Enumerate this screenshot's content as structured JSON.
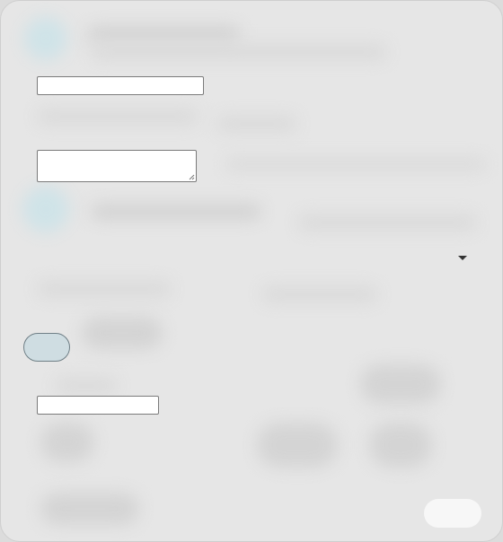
{
  "form": {
    "name_input": {
      "value": "",
      "placeholder": ""
    },
    "notes_textarea": {
      "value": "",
      "placeholder": ""
    },
    "select": {
      "selected": ""
    },
    "toggle_button_label": "",
    "short_input": {
      "value": "",
      "placeholder": ""
    },
    "submit_button_label": ""
  },
  "colors": {
    "dialog_background": "#e6e6e6",
    "field_border": "#7a7a7a",
    "toggle_fill": "#cfdde2",
    "toggle_border": "#6f7f86",
    "submit_fill": "#f7f7f7",
    "ghost_accent": "#cfe3e8"
  },
  "icons": {
    "dropdown": "chevron-down-icon",
    "resize": "resize-grip-icon"
  }
}
